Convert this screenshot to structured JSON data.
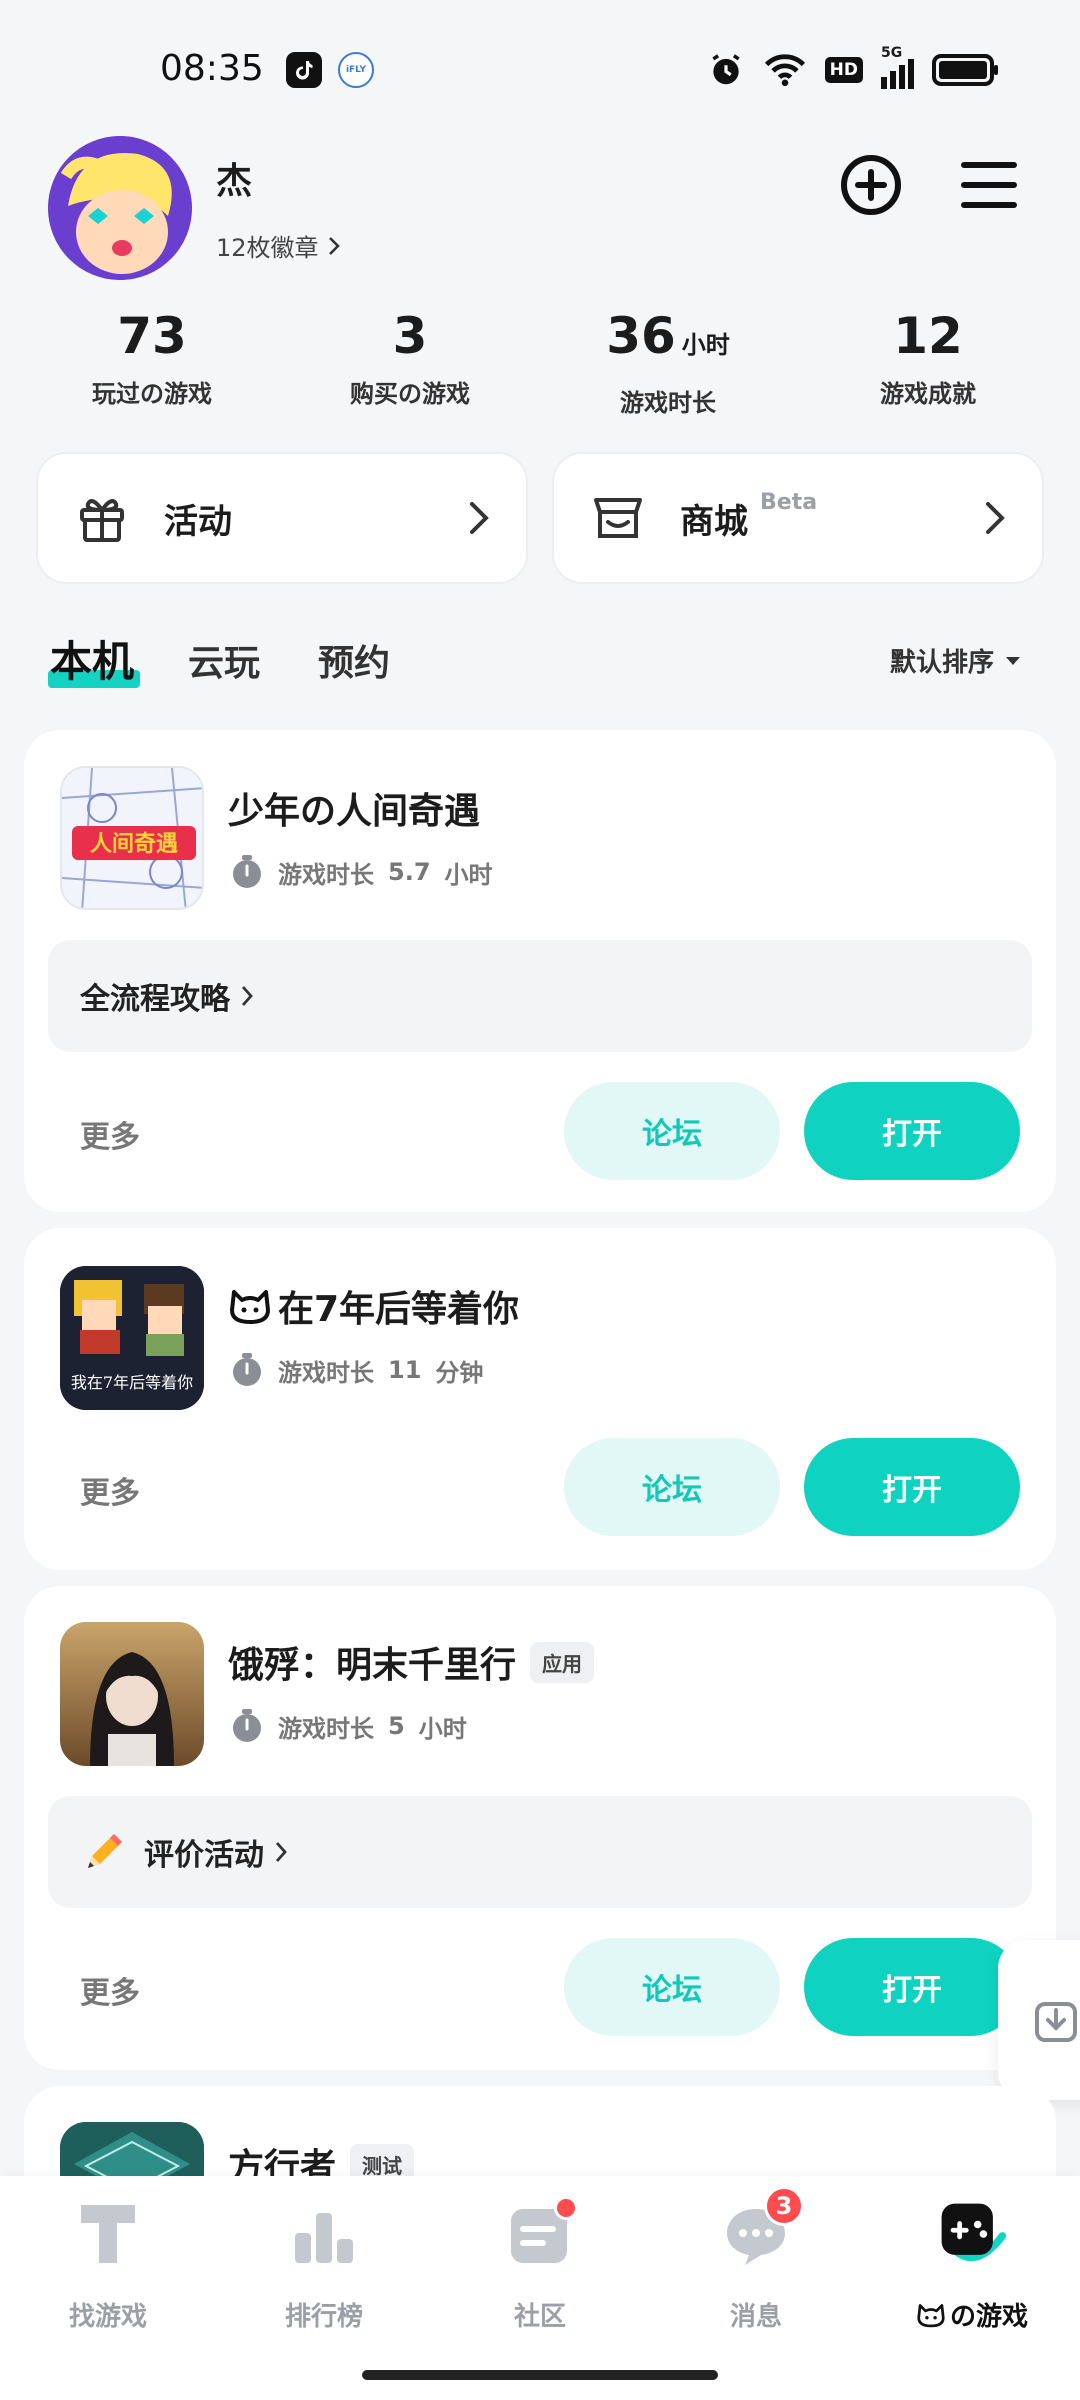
{
  "status_bar": {
    "time": "08:35",
    "app_icons": [
      "tiktok-icon",
      "ifly-icon"
    ],
    "ifly_label": "iFLY",
    "hd_label": "HD",
    "network_label": "5G",
    "right_icons": [
      "alarm-icon",
      "wifi-icon",
      "hd-icon",
      "signal-icon",
      "battery-icon"
    ]
  },
  "profile": {
    "username": "杰",
    "badges_text": "12枚徽章"
  },
  "stats": [
    {
      "value": "73",
      "unit": "",
      "label": "玩过の游戏"
    },
    {
      "value": "3",
      "unit": "",
      "label": "购买の游戏"
    },
    {
      "value": "36",
      "unit": "小时",
      "label": "游戏时长"
    },
    {
      "value": "12",
      "unit": "",
      "label": "游戏成就"
    }
  ],
  "quick_cards": [
    {
      "label": "活动",
      "beta": "",
      "icon": "gift-icon"
    },
    {
      "label": "商城",
      "beta": "Beta",
      "icon": "shop-icon"
    }
  ],
  "tabs": [
    {
      "label": "本机",
      "active": true
    },
    {
      "label": "云玩",
      "active": false
    },
    {
      "label": "预约",
      "active": false
    }
  ],
  "sort_label": "默认排序",
  "games": [
    {
      "title": "少年の人间奇遇",
      "tag": "",
      "playtime_label": "游戏时长",
      "playtime_value": "5.7",
      "playtime_unit": "小时",
      "guide": "全流程攻略",
      "icon_text": "人间奇遇",
      "more": "更多",
      "forum": "论坛",
      "open": "打开"
    },
    {
      "title": "在7年后等着你",
      "tag": "",
      "playtime_label": "游戏时长",
      "playtime_value": "11",
      "playtime_unit": "分钟",
      "guide": "",
      "icon_text": "我在7年后等着你",
      "more": "更多",
      "forum": "论坛",
      "open": "打开"
    },
    {
      "title": "饿殍：明末千里行",
      "tag": "应用",
      "playtime_label": "游戏时长",
      "playtime_value": "5",
      "playtime_unit": "小时",
      "guide": "评价活动",
      "guide_icon": "pencil-icon",
      "more": "更多",
      "forum": "论坛",
      "open": "打开"
    },
    {
      "title": "方行者",
      "tag": "测试"
    }
  ],
  "bottom_nav": [
    {
      "label": "找游戏",
      "icon": "find-game-icon",
      "active": false
    },
    {
      "label": "排行榜",
      "icon": "ranking-icon",
      "active": false
    },
    {
      "label": "社区",
      "icon": "community-icon",
      "active": false,
      "dot": true
    },
    {
      "label": "消息",
      "icon": "message-icon",
      "active": false,
      "badge": "3"
    },
    {
      "label": "の游戏",
      "icon": "my-games-icon",
      "active": true
    }
  ],
  "colors": {
    "accent": "#0fd3c0",
    "accent_light": "#e2f8f6",
    "badge_red": "#ff4d4f"
  }
}
